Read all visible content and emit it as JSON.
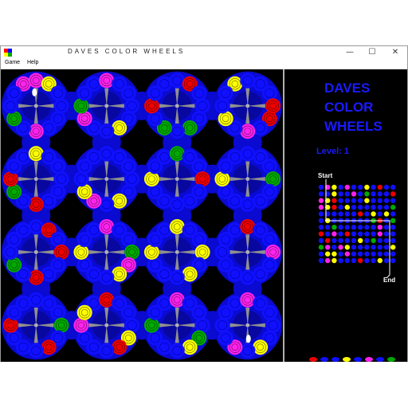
{
  "window": {
    "title": "DAVES  COLOR  WHEELS",
    "minimize_glyph": "—",
    "maximize_glyph": "☐",
    "close_glyph": "✕"
  },
  "menu": {
    "items": [
      "Game",
      "Help"
    ]
  },
  "side_panel": {
    "title_lines": [
      "DAVES",
      "COLOR",
      "WHEELS"
    ],
    "level_label": "Level: 1",
    "start_label": "Start",
    "end_label": "End"
  },
  "colors": {
    "background": "#000000",
    "wheel_blue": "#0a0ad0",
    "ball_blue": "#1010ff",
    "magenta": "#ff22ee",
    "yellow": "#ffff00",
    "red": "#ee0000",
    "green": "#00aa00",
    "title_blue": "#1a1aff",
    "spoke_gray": "#909090"
  },
  "board": {
    "rows": 4,
    "cols": 4,
    "wheels": [
      {
        "balls": [
          "magenta",
          "magenta",
          "yellow",
          "blue",
          "blue",
          "blue",
          "blue",
          "magenta",
          "blue",
          "green",
          "blue",
          "blue"
        ],
        "marker": true
      },
      {
        "balls": [
          "blue",
          "magenta",
          "blue",
          "blue",
          "blue",
          "blue",
          "yellow",
          "blue",
          "blue",
          "magenta",
          "green",
          "blue"
        ]
      },
      {
        "balls": [
          "blue",
          "blue",
          "red",
          "blue",
          "blue",
          "blue",
          "green",
          "blue",
          "green",
          "blue",
          "red",
          "blue"
        ]
      },
      {
        "balls": [
          "yellow",
          "blue",
          "blue",
          "blue",
          "red",
          "red",
          "blue",
          "magenta",
          "blue",
          "yellow",
          "blue",
          "blue"
        ]
      },
      {
        "balls": [
          "blue",
          "yellow",
          "blue",
          "blue",
          "blue",
          "blue",
          "blue",
          "red",
          "blue",
          "green",
          "red",
          "blue"
        ]
      },
      {
        "balls": [
          "blue",
          "blue",
          "blue",
          "blue",
          "blue",
          "blue",
          "yellow",
          "blue",
          "magenta",
          "yellow",
          "blue",
          "blue"
        ]
      },
      {
        "balls": [
          "blue",
          "green",
          "blue",
          "blue",
          "red",
          "blue",
          "blue",
          "blue",
          "blue",
          "blue",
          "yellow",
          "blue"
        ]
      },
      {
        "balls": [
          "blue",
          "blue",
          "blue",
          "blue",
          "green",
          "blue",
          "blue",
          "blue",
          "blue",
          "blue",
          "yellow",
          "blue"
        ]
      },
      {
        "balls": [
          "blue",
          "blue",
          "red",
          "blue",
          "red",
          "blue",
          "blue",
          "red",
          "blue",
          "green",
          "blue",
          "blue"
        ]
      },
      {
        "balls": [
          "blue",
          "magenta",
          "blue",
          "blue",
          "green",
          "magenta",
          "yellow",
          "blue",
          "blue",
          "blue",
          "yellow",
          "blue"
        ]
      },
      {
        "balls": [
          "blue",
          "yellow",
          "blue",
          "blue",
          "yellow",
          "blue",
          "yellow",
          "blue",
          "blue",
          "blue",
          "yellow",
          "blue"
        ]
      },
      {
        "balls": [
          "blue",
          "red",
          "blue",
          "blue",
          "magenta",
          "blue",
          "blue",
          "blue",
          "blue",
          "blue",
          "blue",
          "blue"
        ]
      },
      {
        "balls": [
          "blue",
          "blue",
          "blue",
          "blue",
          "green",
          "blue",
          "red",
          "blue",
          "blue",
          "blue",
          "red",
          "blue"
        ]
      },
      {
        "balls": [
          "blue",
          "red",
          "blue",
          "blue",
          "blue",
          "yellow",
          "red",
          "blue",
          "blue",
          "blue",
          "magenta",
          "yellow"
        ]
      },
      {
        "balls": [
          "blue",
          "magenta",
          "blue",
          "blue",
          "blue",
          "green",
          "yellow",
          "blue",
          "blue",
          "blue",
          "green",
          "blue"
        ]
      },
      {
        "balls": [
          "blue",
          "magenta",
          "blue",
          "blue",
          "blue",
          "blue",
          "yellow",
          "blue",
          "magenta",
          "blue",
          "blue",
          "blue"
        ],
        "marker": true
      }
    ],
    "connectors": [
      "blue",
      "blue",
      "blue",
      "blue",
      "blue",
      "blue",
      "blue",
      "blue",
      "blue",
      "blue",
      "blue",
      "blue"
    ]
  },
  "minimap": {
    "rows": 12,
    "cols": 12,
    "dots": "bmybmbbybrbbbbybbmbgbbbrmyrbbbbybbbbmyrbybbbbbbgbbbbbbrbybybbybbbbbbgrbgbbgbbbbbbmbbrbmbrbbbbmbbbrbbbbybgbbbgmbmybbbbbbybyybmbbbbbbbbmybbbrbbybbbb"
  },
  "tray": {
    "balls": [
      "red",
      "blue",
      "blue",
      "yellow",
      "blue",
      "magenta",
      "blue",
      "green"
    ]
  }
}
